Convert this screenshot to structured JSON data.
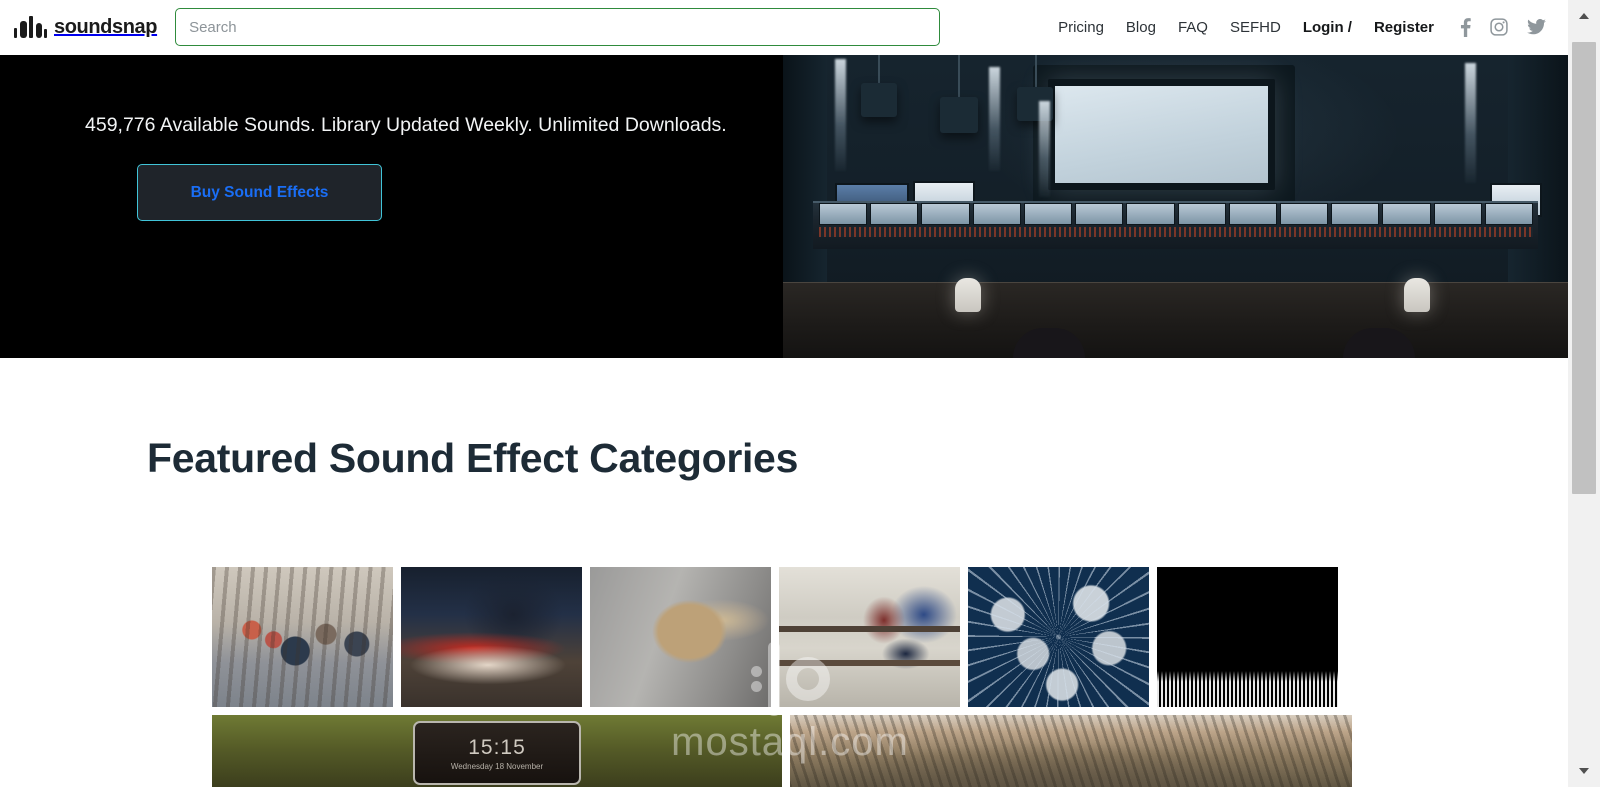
{
  "header": {
    "logo_text": "soundsnap",
    "logo_icon": "waveform-icon",
    "search": {
      "value": "",
      "placeholder": "Search"
    },
    "nav": [
      {
        "label": "Pricing",
        "bold": false
      },
      {
        "label": "Blog",
        "bold": false
      },
      {
        "label": "FAQ",
        "bold": false
      },
      {
        "label": "SEFHD",
        "bold": false
      },
      {
        "label": "Login /",
        "bold": true
      },
      {
        "label": "Register",
        "bold": true
      }
    ],
    "social": [
      {
        "name": "facebook-icon",
        "glyph": "f"
      },
      {
        "name": "instagram-icon",
        "glyph": "▢"
      },
      {
        "name": "twitter-icon",
        "glyph": "ᴠ"
      }
    ]
  },
  "hero": {
    "tagline": "459,776 Available Sounds. Library Updated Weekly. Unlimited Downloads.",
    "button_label": "Buy Sound Effects",
    "button_border_color": "#41c4d8",
    "button_text_color": "#1a6ef5",
    "background_color": "#000000",
    "image_alt": "dark recording studio control room with mixing console and projection screen"
  },
  "section": {
    "title": "Featured Sound Effect Categories",
    "title_color": "#1d2b36"
  },
  "tiles": {
    "row1": [
      {
        "name": "tile-ambience-crowd",
        "alt": "outdoor cafe terrace crowd"
      },
      {
        "name": "tile-traffic-light-trails",
        "alt": "night road car light trails"
      },
      {
        "name": "tile-wind-hair",
        "alt": "blonde hair blown by wind, black and white"
      },
      {
        "name": "tile-footsteps",
        "alt": "shoes walking down stone stairs"
      },
      {
        "name": "tile-explosions",
        "alt": "cartoon explosion burst on navy background"
      },
      {
        "name": "tile-applause",
        "alt": "dark crowd silhouette applause"
      }
    ],
    "row2": [
      {
        "name": "tile-phone-ringtones",
        "alt": "hand holding phone lock screen",
        "clock": "15:15",
        "date": "Wednesday 18 November"
      },
      {
        "name": "tile-nature",
        "alt": "dry hillside landscape"
      }
    ]
  },
  "watermark": {
    "text": "mostaql.com",
    "logo": "mostaql-logo-icon"
  },
  "scrollbar": {
    "up_icon": "scroll-up-arrow-icon",
    "down_icon": "scroll-down-arrow-icon"
  }
}
